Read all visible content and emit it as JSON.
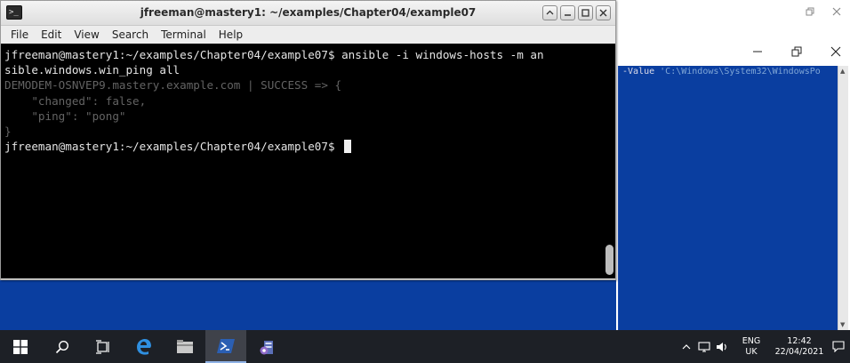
{
  "terminal": {
    "title": "jfreeman@mastery1: ~/examples/Chapter04/example07",
    "icon_glyph": ">_",
    "menu": [
      "File",
      "Edit",
      "View",
      "Search",
      "Terminal",
      "Help"
    ],
    "lines": [
      {
        "text": "jfreeman@mastery1:~/examples/Chapter04/example07$ ansible -i windows-hosts -m an",
        "style": "normal"
      },
      {
        "text": "sible.windows.win_ping all",
        "style": "normal"
      },
      {
        "text": "DEMODEM-OSNVEP9.mastery.example.com | SUCCESS => {",
        "style": "dim"
      },
      {
        "text": "    \"changed\": false,",
        "style": "dim"
      },
      {
        "text": "    \"ping\": \"pong\"",
        "style": "dim"
      },
      {
        "text": "}",
        "style": "dim"
      }
    ],
    "prompt": "jfreeman@mastery1:~/examples/Chapter04/example07$ "
  },
  "powershell": {
    "line_value": "-Value",
    "line_path": "'C:\\Windows\\System32\\WindowsPo"
  },
  "taskbar": {
    "items": [
      "start-icon",
      "search-icon",
      "task-view-icon",
      "edge-icon",
      "file-explorer-icon",
      "powershell-icon",
      "server-manager-icon"
    ],
    "lang_top": "ENG",
    "lang_bottom": "UK",
    "time": "12:42",
    "date": "22/04/2021"
  },
  "colors": {
    "terminal_bg": "#000000",
    "powershell_bg": "#0a3ea0",
    "taskbar_bg": "#1d2026"
  }
}
